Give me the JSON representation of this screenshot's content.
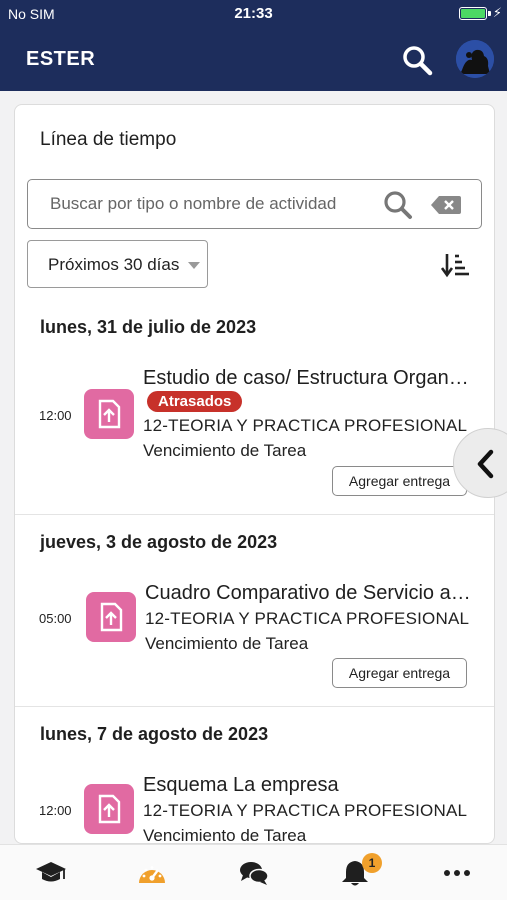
{
  "status_bar": {
    "carrier": "No SIM",
    "time": "21:33",
    "battery_percent": 100
  },
  "header": {
    "title": "ESTER"
  },
  "timeline": {
    "title": "Línea de tiempo",
    "search_placeholder": "Buscar por tipo o nombre de actividad",
    "filter_selected": "Próximos 30 días",
    "groups": [
      {
        "date": "lunes, 31 de julio de 2023",
        "event": {
          "time": "12:00",
          "title": "Estudio de caso/ Estructura Organizacional",
          "badge": "Atrasados",
          "course": "12-TEORIA Y PRACTICA PROFESIONAL",
          "due": "Vencimiento de Tarea",
          "action": "Agregar entrega"
        }
      },
      {
        "date": "jueves, 3 de agosto de 2023",
        "event": {
          "time": "05:00",
          "title": "Cuadro Comparativo de Servicio al Cliente",
          "course": "12-TEORIA Y PRACTICA PROFESIONAL",
          "due": "Vencimiento de Tarea",
          "action": "Agregar entrega"
        }
      },
      {
        "date": "lunes, 7 de agosto de 2023",
        "event": {
          "time": "12:00",
          "title": "Esquema La empresa",
          "course": "12-TEORIA Y PRACTICA PROFESIONAL",
          "due": "Vencimiento de Tarea"
        }
      }
    ]
  },
  "bottom_nav": {
    "items": [
      "courses-icon",
      "dashboard-icon",
      "messages-icon",
      "notifications-icon",
      "more-icon"
    ],
    "notification_count": "1",
    "active": "dashboard-icon"
  },
  "colors": {
    "header_bg": "#1d2d5c",
    "assignment_icon": "#e16aa2",
    "overdue_badge": "#c7312a",
    "active_nav": "#f0a02c"
  }
}
